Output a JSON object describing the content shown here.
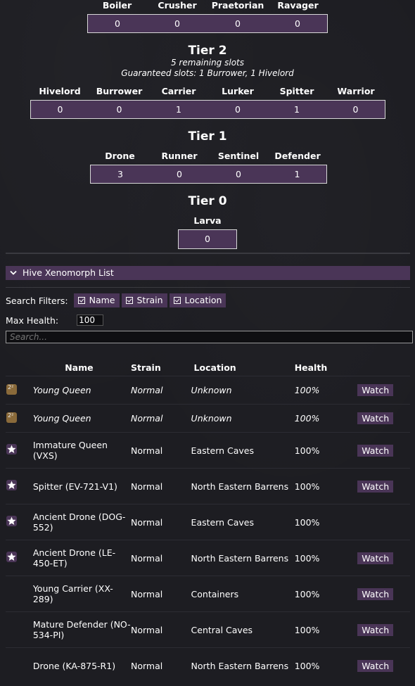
{
  "tiers": {
    "tier3": {
      "slots": [
        {
          "name": "Boiler",
          "value": "0"
        },
        {
          "name": "Crusher",
          "value": "0"
        },
        {
          "name": "Praetorian",
          "value": "0"
        },
        {
          "name": "Ravager",
          "value": "0"
        }
      ]
    },
    "tier2": {
      "title": "Tier 2",
      "remaining": "5 remaining slots",
      "guaranteed": "Guaranteed slots: 1 Burrower, 1 Hivelord",
      "slots": [
        {
          "name": "Hivelord",
          "value": "0"
        },
        {
          "name": "Burrower",
          "value": "0"
        },
        {
          "name": "Carrier",
          "value": "1"
        },
        {
          "name": "Lurker",
          "value": "0"
        },
        {
          "name": "Spitter",
          "value": "1"
        },
        {
          "name": "Warrior",
          "value": "0"
        }
      ]
    },
    "tier1": {
      "title": "Tier 1",
      "slots": [
        {
          "name": "Drone",
          "value": "3"
        },
        {
          "name": "Runner",
          "value": "0"
        },
        {
          "name": "Sentinel",
          "value": "0"
        },
        {
          "name": "Defender",
          "value": "1"
        }
      ]
    },
    "tier0": {
      "title": "Tier 0",
      "slots": [
        {
          "name": "Larva",
          "value": "0"
        }
      ]
    }
  },
  "list_section": {
    "title": "Hive Xenomorph List",
    "filters_label": "Search Filters:",
    "filters": [
      "Name",
      "Strain",
      "Location"
    ],
    "max_health_label": "Max Health:",
    "max_health_value": "100",
    "search_placeholder": "Search...",
    "columns": [
      "Name",
      "Strain",
      "Location",
      "Health"
    ],
    "rows": [
      {
        "icon": "dice-icon",
        "name": "Young Queen",
        "strain": "Normal",
        "location": "Unknown",
        "health": "100%",
        "action": "Watch",
        "italic": true
      },
      {
        "icon": "dice-icon",
        "name": "Young Queen",
        "strain": "Normal",
        "location": "Unknown",
        "health": "100%",
        "action": "Watch",
        "italic": true
      },
      {
        "icon": "star-icon",
        "name": "Immature Queen (VXS)",
        "strain": "Normal",
        "location": "Eastern Caves",
        "health": "100%",
        "action": "Watch",
        "italic": false
      },
      {
        "icon": "star-icon",
        "name": "Spitter (EV-721-V1)",
        "strain": "Normal",
        "location": "North Eastern Barrens",
        "health": "100%",
        "action": "Watch",
        "italic": false
      },
      {
        "icon": "star-icon",
        "name": "Ancient Drone (DOG-552)",
        "strain": "Normal",
        "location": "Eastern Caves",
        "health": "100%",
        "action": "",
        "italic": false
      },
      {
        "icon": "star-icon",
        "name": "Ancient Drone (LE-450-ET)",
        "strain": "Normal",
        "location": "North Eastern Barrens",
        "health": "100%",
        "action": "Watch",
        "italic": false
      },
      {
        "icon": "",
        "name": "Young Carrier (XX-289)",
        "strain": "Normal",
        "location": "Containers",
        "health": "100%",
        "action": "Watch",
        "italic": false
      },
      {
        "icon": "",
        "name": "Mature Defender (NO-534-PI)",
        "strain": "Normal",
        "location": "Central Caves",
        "health": "100%",
        "action": "Watch",
        "italic": false
      },
      {
        "icon": "",
        "name": "Drone (KA-875-R1)",
        "strain": "Normal",
        "location": "North Eastern Barrens",
        "health": "100%",
        "action": "Watch",
        "italic": false
      }
    ]
  }
}
